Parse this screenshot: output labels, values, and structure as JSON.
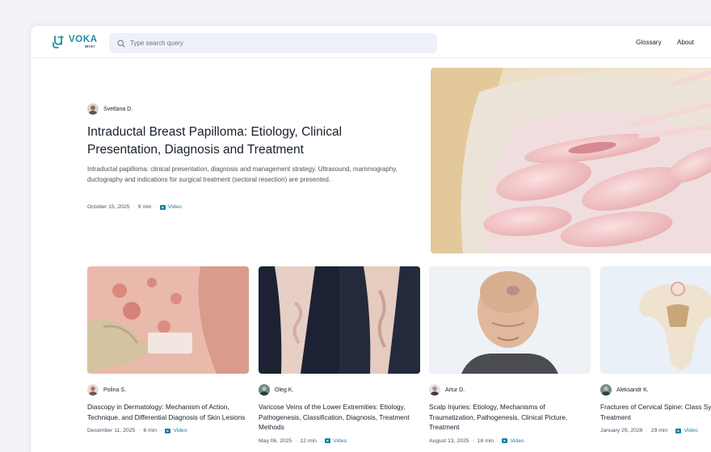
{
  "header": {
    "logo_word": "VOKA",
    "logo_sub": "WIKI",
    "search_placeholder": "Type search query",
    "nav": [
      "Glossary",
      "About"
    ]
  },
  "hero": {
    "author": "Svetlana D.",
    "title": "Intraductal Breast Papilloma: Etiology, Clinical Presentation, Diagnosis and Treatment",
    "description": "Intraductal papilloma: clinical presentation, diagnosis and management strategy. Ultrasound, mammography, ductography and indications for surgical treatment (sectoral resection) are presented.",
    "date": "October 15, 2025",
    "duration": "9 min",
    "media": "Video"
  },
  "cards": [
    {
      "author": "Polina S.",
      "title": "Diascopy in Dermatology: Mechanism of Action, Technique, and Differential Diagnosis of Skin Lesions",
      "date": "December 11, 2025",
      "duration": "6 min",
      "media": "Video"
    },
    {
      "author": "Oleg K.",
      "title": "Varicose Veins of the Lower Extremities: Etiology, Pathogenesis, Classification, Diagnosis, Treatment Methods",
      "date": "May 06, 2025",
      "duration": "12 min",
      "media": "Video"
    },
    {
      "author": "Artur D.",
      "title": "Scalp Injuries: Etiology, Mechanisms of Traumatization, Pathogenesis, Clinical Picture, Treatment",
      "date": "August 13, 2025",
      "duration": "18 min",
      "media": "Video"
    },
    {
      "author": "Aleksandr K.",
      "title": "Fractures of Cervical Spine: Class Symptoms, and Treatment",
      "date": "January 29, 2026",
      "duration": "29 min",
      "media": "Video"
    }
  ],
  "colors": {
    "accent": "#1e8fa3",
    "link": "#1c7fa0"
  }
}
